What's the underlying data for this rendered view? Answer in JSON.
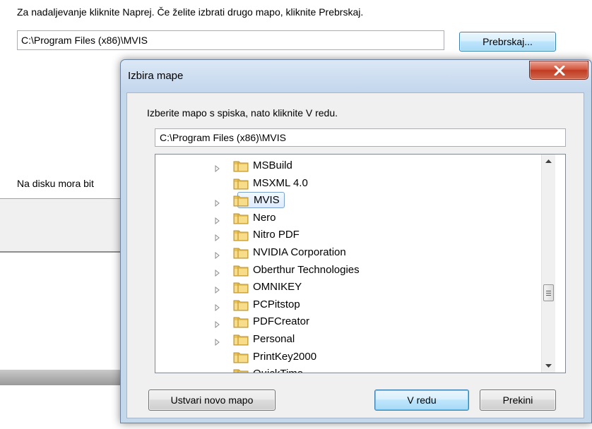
{
  "installer": {
    "instruction": "Za nadaljevanje kliknite Naprej. Če želite izbrati drugo mapo, kliknite Prebrskaj.",
    "path_value": "C:\\Program Files (x86)\\MVIS",
    "browse_label": "Prebrskaj...",
    "disk_text": "Na disku mora bit"
  },
  "dialog": {
    "title": "Izbira mape",
    "instruction": "Izberite mapo s spiska, nato kliknite V redu.",
    "path_value": "C:\\Program Files (x86)\\MVIS",
    "tree_items": [
      {
        "label": "MSBuild",
        "expandable": true,
        "selected": false
      },
      {
        "label": "MSXML 4.0",
        "expandable": false,
        "selected": false
      },
      {
        "label": "MVIS",
        "expandable": true,
        "selected": true
      },
      {
        "label": "Nero",
        "expandable": true,
        "selected": false
      },
      {
        "label": "Nitro PDF",
        "expandable": true,
        "selected": false
      },
      {
        "label": "NVIDIA Corporation",
        "expandable": true,
        "selected": false
      },
      {
        "label": "Oberthur Technologies",
        "expandable": true,
        "selected": false
      },
      {
        "label": "OMNIKEY",
        "expandable": true,
        "selected": false
      },
      {
        "label": "PCPitstop",
        "expandable": true,
        "selected": false
      },
      {
        "label": "PDFCreator",
        "expandable": true,
        "selected": false
      },
      {
        "label": "Personal",
        "expandable": true,
        "selected": false
      },
      {
        "label": "PrintKey2000",
        "expandable": false,
        "selected": false
      },
      {
        "label": "QuickTime",
        "expandable": true,
        "selected": false
      }
    ],
    "buttons": {
      "new_folder": "Ustvari novo mapo",
      "ok": "V redu",
      "cancel": "Prekini"
    }
  },
  "colors": {
    "accent": "#3c7fb1",
    "close": "#c13b23",
    "folder": "#e8c35c"
  }
}
